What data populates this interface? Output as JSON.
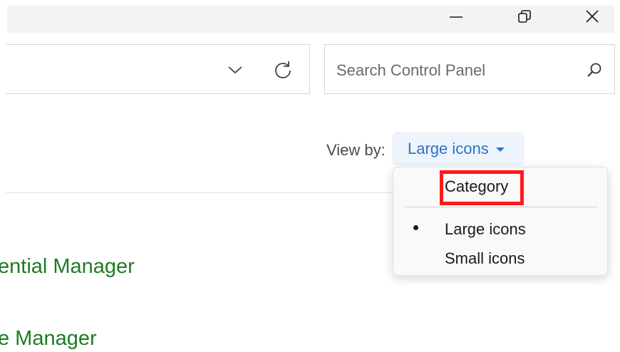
{
  "window": {
    "minimize_icon": "minimize-icon",
    "restore_icon": "restore-icon",
    "close_icon": "close-icon"
  },
  "address_bar": {
    "dropdown_icon": "chevron-down-icon",
    "refresh_icon": "refresh-icon"
  },
  "search": {
    "placeholder": "Search Control Panel",
    "icon": "search-icon"
  },
  "view_by": {
    "label": "View by:",
    "value": "Large icons"
  },
  "view_menu": {
    "items": [
      {
        "label": "Category",
        "selected": false,
        "highlighted": true
      },
      {
        "label": "Large icons",
        "selected": true
      },
      {
        "label": "Small icons",
        "selected": false
      }
    ]
  },
  "links": [
    {
      "label": "ential Manager"
    },
    {
      "label": "e Manager"
    }
  ],
  "colors": {
    "link": "#1e7b24",
    "accent": "#2b73c9",
    "highlight": "#ff1a1a"
  }
}
